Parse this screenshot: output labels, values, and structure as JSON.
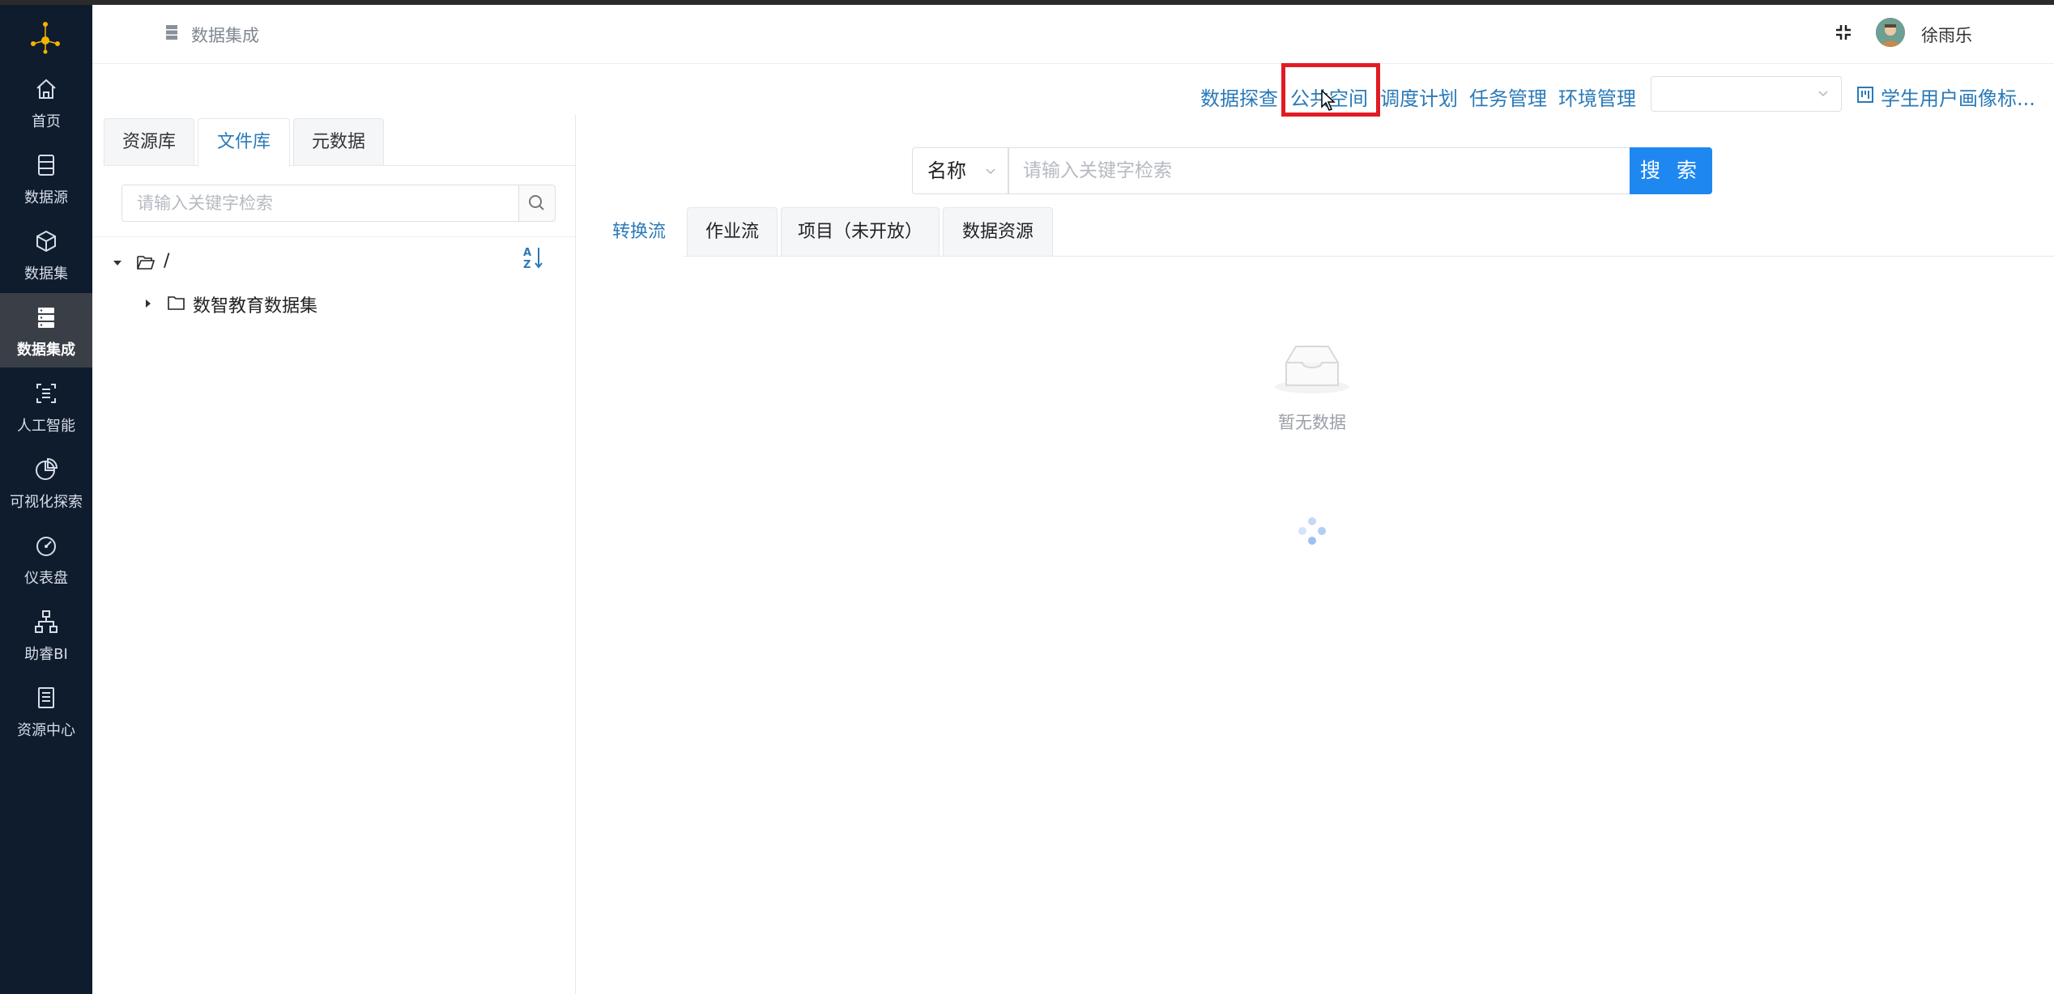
{
  "sidebar": {
    "items": [
      {
        "label": "首页",
        "icon": "home-icon"
      },
      {
        "label": "数据源",
        "icon": "database-icon"
      },
      {
        "label": "数据集",
        "icon": "cube-icon"
      },
      {
        "label": "数据集成",
        "icon": "server-icon",
        "active": true
      },
      {
        "label": "人工智能",
        "icon": "ai-scan-icon"
      },
      {
        "label": "可视化探索",
        "icon": "pie-chart-icon"
      },
      {
        "label": "仪表盘",
        "icon": "gauge-icon"
      },
      {
        "label": "助睿BI",
        "icon": "org-chart-icon"
      },
      {
        "label": "资源中心",
        "icon": "document-icon"
      }
    ],
    "bg_color": "#0f1c2e"
  },
  "header": {
    "breadcrumb": "数据集成",
    "username": "徐雨乐"
  },
  "toolbar": {
    "links": [
      "数据探查",
      "公共空间",
      "调度计划",
      "任务管理",
      "环境管理"
    ],
    "highlighted": "公共空间",
    "select_value": "",
    "project": "学生用户画像标..."
  },
  "left": {
    "tabs": [
      "资源库",
      "文件库",
      "元数据"
    ],
    "active_tab": "文件库",
    "search_placeholder": "请输入关键字检索",
    "tree": {
      "root": "/",
      "children": [
        "数智教育数据集"
      ]
    }
  },
  "right": {
    "search_field": "名称",
    "search_placeholder": "请输入关键字检索",
    "search_button": "搜 索",
    "tabs": [
      "转换流",
      "作业流",
      "项目（未开放）",
      "数据资源"
    ],
    "active_tab": "转换流",
    "empty_text": "暂无数据"
  },
  "colors": {
    "accent": "#2a7ab8",
    "primary_button": "#1e88f0",
    "highlight_box": "#e21b23"
  }
}
